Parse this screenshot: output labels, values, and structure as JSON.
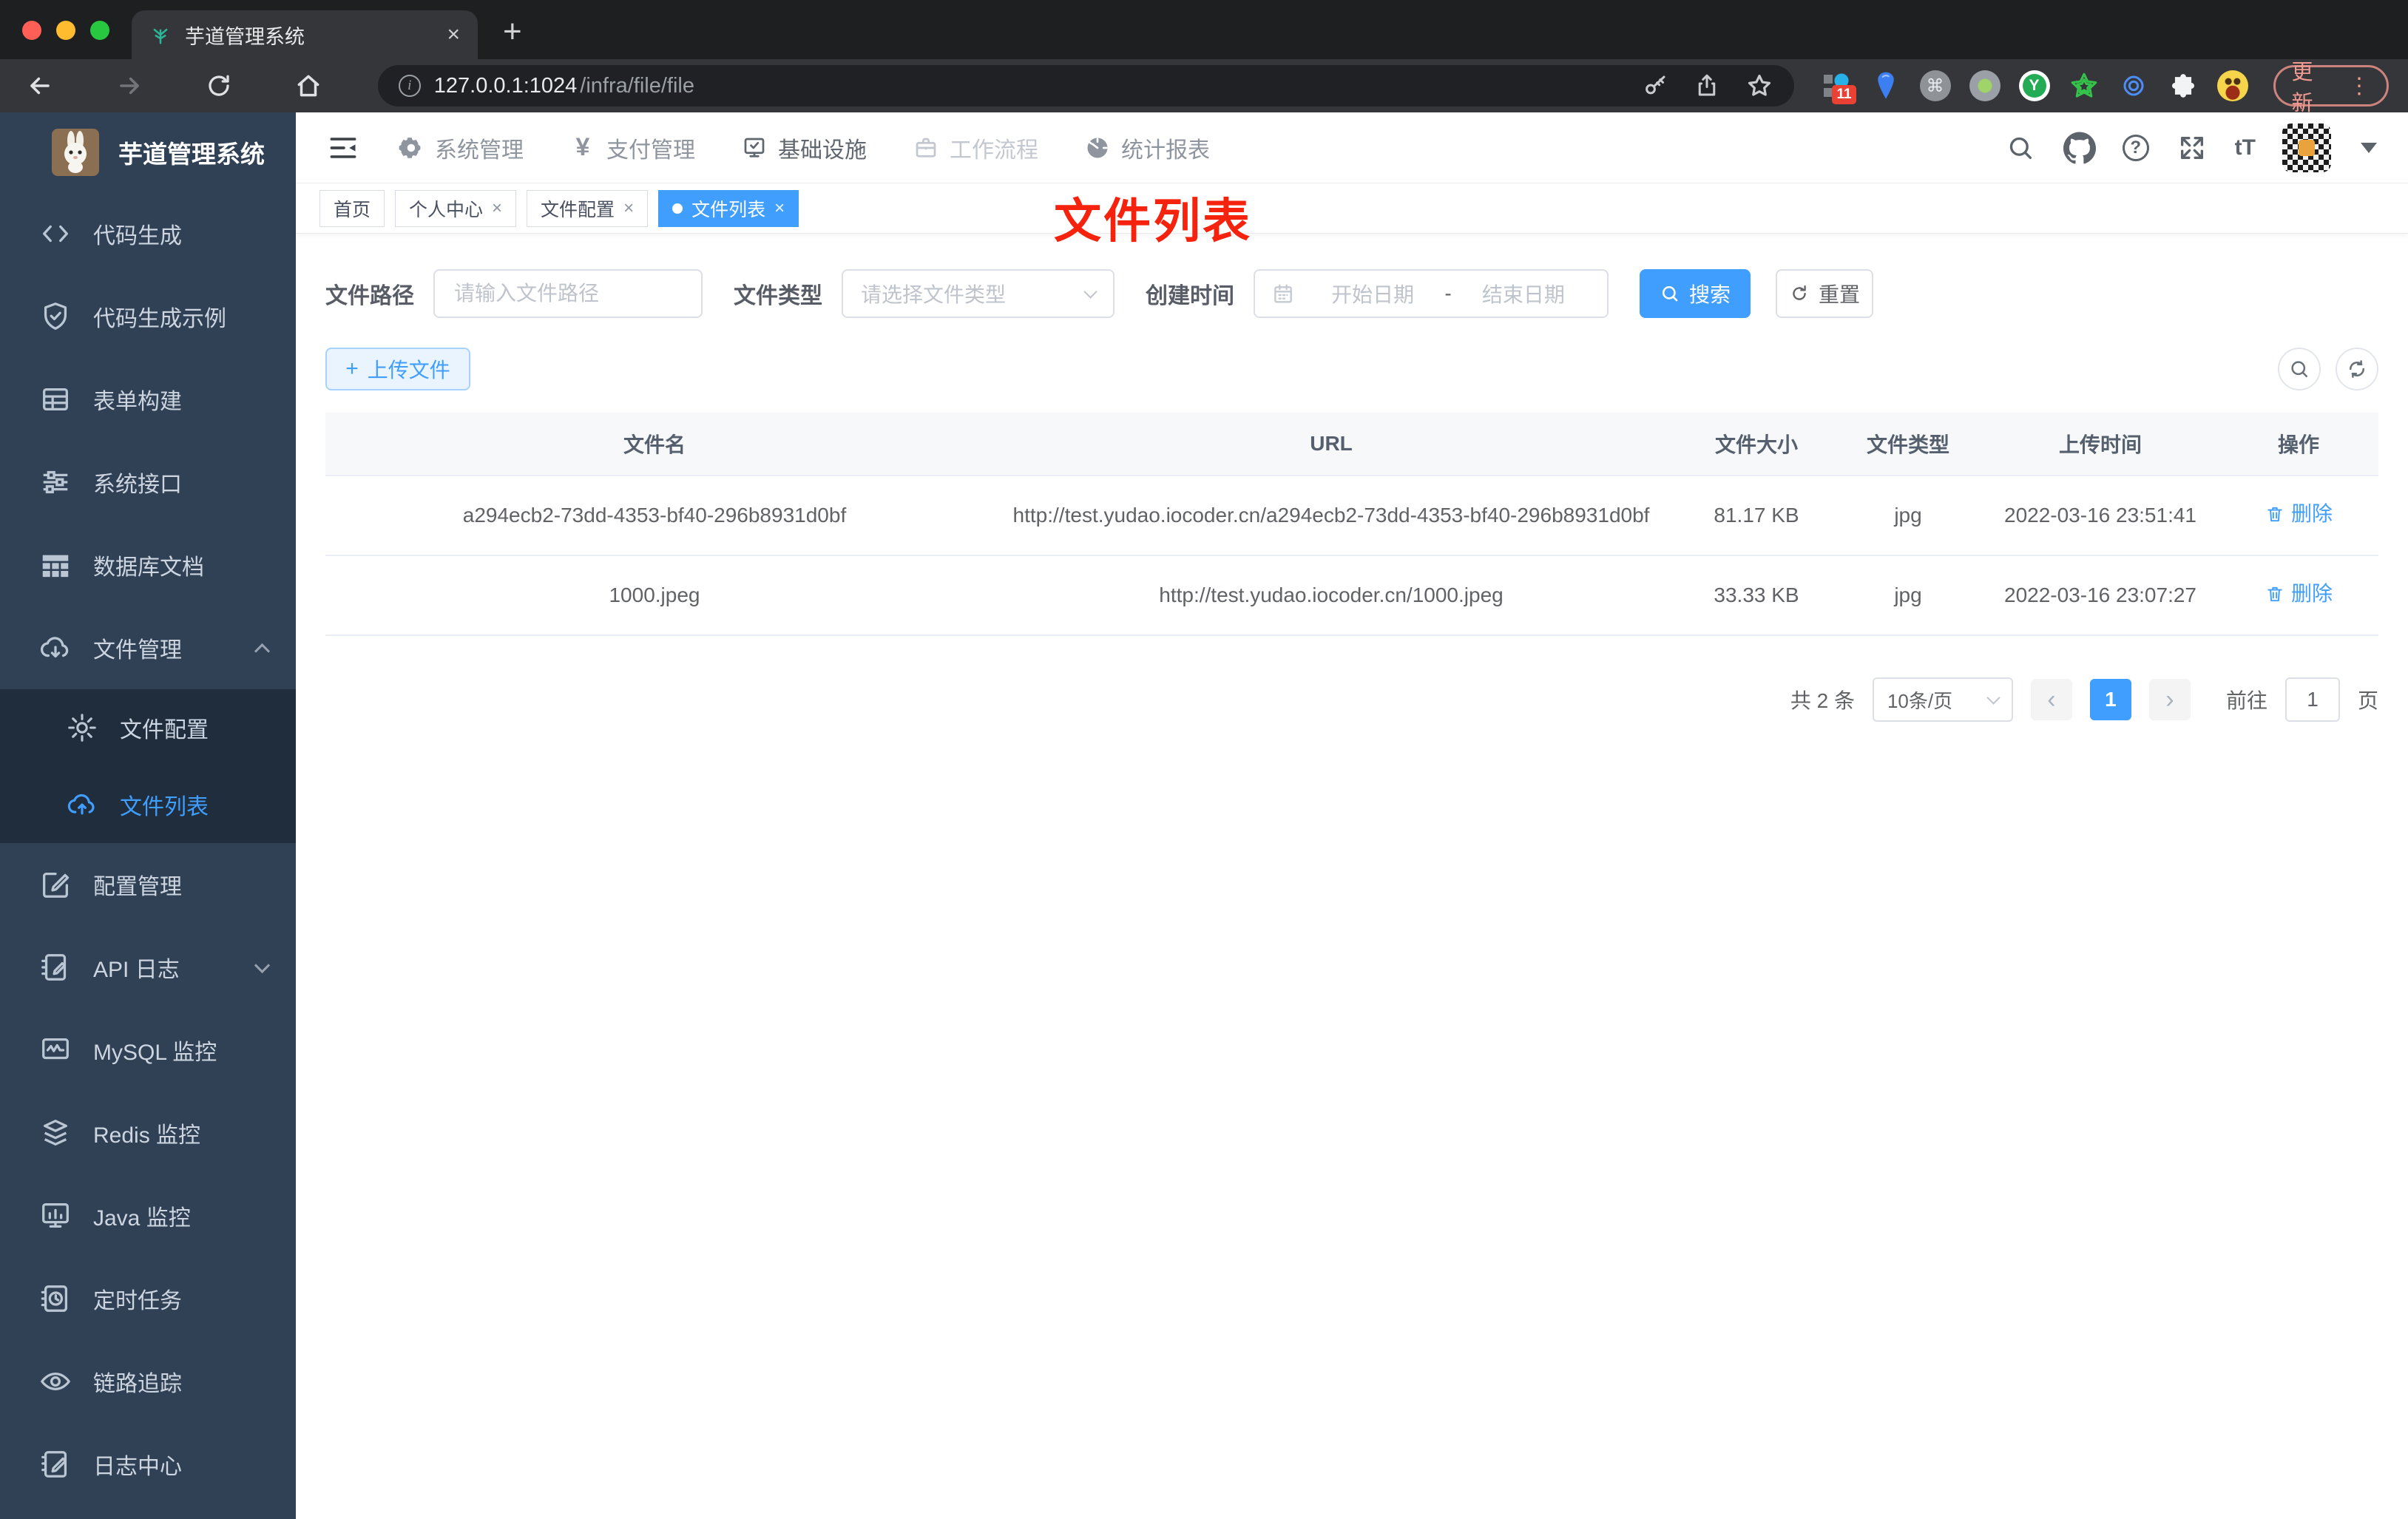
{
  "glyphs": {
    "plus": "+",
    "close": "×",
    "question": "?",
    "yen": "¥",
    "font_size": "tT",
    "kebab": "⋮",
    "prev": "‹",
    "next": "›",
    "info": "i",
    "command": "⌘",
    "y_letter": "Y"
  },
  "browser": {
    "tab_title": "芋道管理系统",
    "url_host": "127.0.0.1:1024",
    "url_path": "/infra/file/file",
    "update_label": "更新",
    "extension_badge": "11"
  },
  "sidebar": {
    "logo_title": "芋道管理系统",
    "items": [
      {
        "label": "代码生成"
      },
      {
        "label": "代码生成示例"
      },
      {
        "label": "表单构建"
      },
      {
        "label": "系统接口"
      },
      {
        "label": "数据库文档"
      },
      {
        "label": "文件管理"
      },
      {
        "label": "文件配置"
      },
      {
        "label": "文件列表"
      },
      {
        "label": "配置管理"
      },
      {
        "label": "API 日志"
      },
      {
        "label": "MySQL 监控"
      },
      {
        "label": "Redis 监控"
      },
      {
        "label": "Java 监控"
      },
      {
        "label": "定时任务"
      },
      {
        "label": "链路追踪"
      },
      {
        "label": "日志中心"
      }
    ]
  },
  "topnav": {
    "items": [
      {
        "label": "系统管理"
      },
      {
        "label": "支付管理"
      },
      {
        "label": "基础设施"
      },
      {
        "label": "工作流程"
      },
      {
        "label": "统计报表"
      }
    ]
  },
  "tags": [
    {
      "label": "首页"
    },
    {
      "label": "个人中心"
    },
    {
      "label": "文件配置"
    },
    {
      "label": "文件列表"
    }
  ],
  "annotation": {
    "text": "文件列表"
  },
  "filters": {
    "path_label": "文件路径",
    "path_placeholder": "请输入文件路径",
    "type_label": "文件类型",
    "type_placeholder": "请选择文件类型",
    "time_label": "创建时间",
    "start_placeholder": "开始日期",
    "range_separator": "-",
    "end_placeholder": "结束日期",
    "search_label": "搜索",
    "reset_label": "重置"
  },
  "toolbar": {
    "upload_label": "上传文件"
  },
  "table": {
    "headers": [
      "文件名",
      "URL",
      "文件大小",
      "文件类型",
      "上传时间",
      "操作"
    ],
    "rows": [
      {
        "name": "a294ecb2-73dd-4353-bf40-296b8931d0bf",
        "url": "http://test.yudao.iocoder.cn/a294ecb2-73dd-4353-bf40-296b8931d0bf",
        "size": "81.17 KB",
        "type": "jpg",
        "time": "2022-03-16 23:51:41",
        "action": "删除"
      },
      {
        "name": "1000.jpeg",
        "url": "http://test.yudao.iocoder.cn/1000.jpeg",
        "size": "33.33 KB",
        "type": "jpg",
        "time": "2022-03-16 23:07:27",
        "action": "删除"
      }
    ]
  },
  "pagination": {
    "total": "共 2 条",
    "page_size": "10条/页",
    "current_page": "1",
    "goto_label": "前往",
    "goto_value": "1",
    "page_unit": "页"
  },
  "colors": {
    "accent": "#409eff",
    "sidebar_bg": "#304156",
    "sidebar_submenu_bg": "#1f2d3d",
    "annotation_red": "#f5220d",
    "browser_dark": "#35363a"
  }
}
